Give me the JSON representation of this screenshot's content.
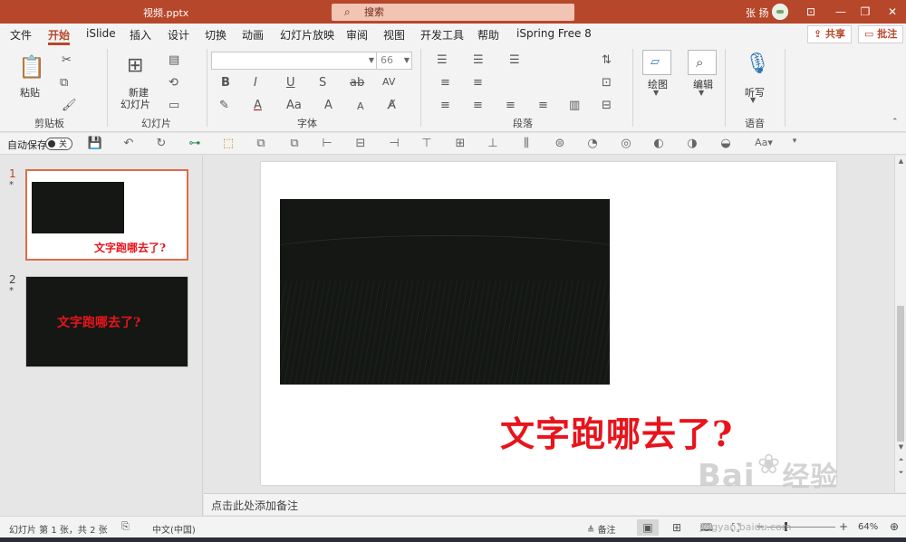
{
  "titlebar": {
    "filename": "视频.pptx",
    "search_placeholder": "搜索",
    "user": "张 扬",
    "win_buttons": [
      "⊡",
      "—",
      "❐",
      "✕"
    ]
  },
  "menu": {
    "tabs": [
      "文件",
      "开始",
      "iSlide",
      "插入",
      "设计",
      "切换",
      "动画",
      "幻灯片放映",
      "审阅",
      "视图",
      "开发工具",
      "帮助",
      "iSpring Free 8"
    ],
    "active": "开始",
    "share": "共享",
    "comments": "批注"
  },
  "ribbon": {
    "clipboard": {
      "paste": "粘贴",
      "label": "剪贴板"
    },
    "slides": {
      "new_slide_line1": "新建",
      "new_slide_line2": "幻灯片",
      "label": "幻灯片"
    },
    "font": {
      "font_name": "",
      "font_size": "66",
      "label": "字体"
    },
    "paragraph": {
      "label": "段落"
    },
    "drawing": {
      "label": "绘图"
    },
    "editing": {
      "label": "编辑"
    },
    "voice": {
      "dictate": "听写",
      "label": "语音"
    }
  },
  "qat": {
    "autosave": "自动保存",
    "toggle_state": "关"
  },
  "thumbnails": [
    {
      "number": "1",
      "marker": "*",
      "text": "文字跑哪去了?"
    },
    {
      "number": "2",
      "marker": "*",
      "text": "文字跑哪去了?"
    }
  ],
  "slide": {
    "title": "文字跑哪去了?"
  },
  "notes": {
    "placeholder": "点击此处添加备注"
  },
  "status": {
    "slide_info": "幻灯片 第 1 张，共 2 张",
    "language": "中文(中国)",
    "notes_button": "备注",
    "zoom": "64%"
  },
  "watermark": {
    "brand": "Bai",
    "brand_cn": "经验",
    "url": "jingyan.baidu.com"
  },
  "colors": {
    "accent": "#b7472a",
    "title_red": "#e8141c",
    "video_bg": "#141713"
  }
}
